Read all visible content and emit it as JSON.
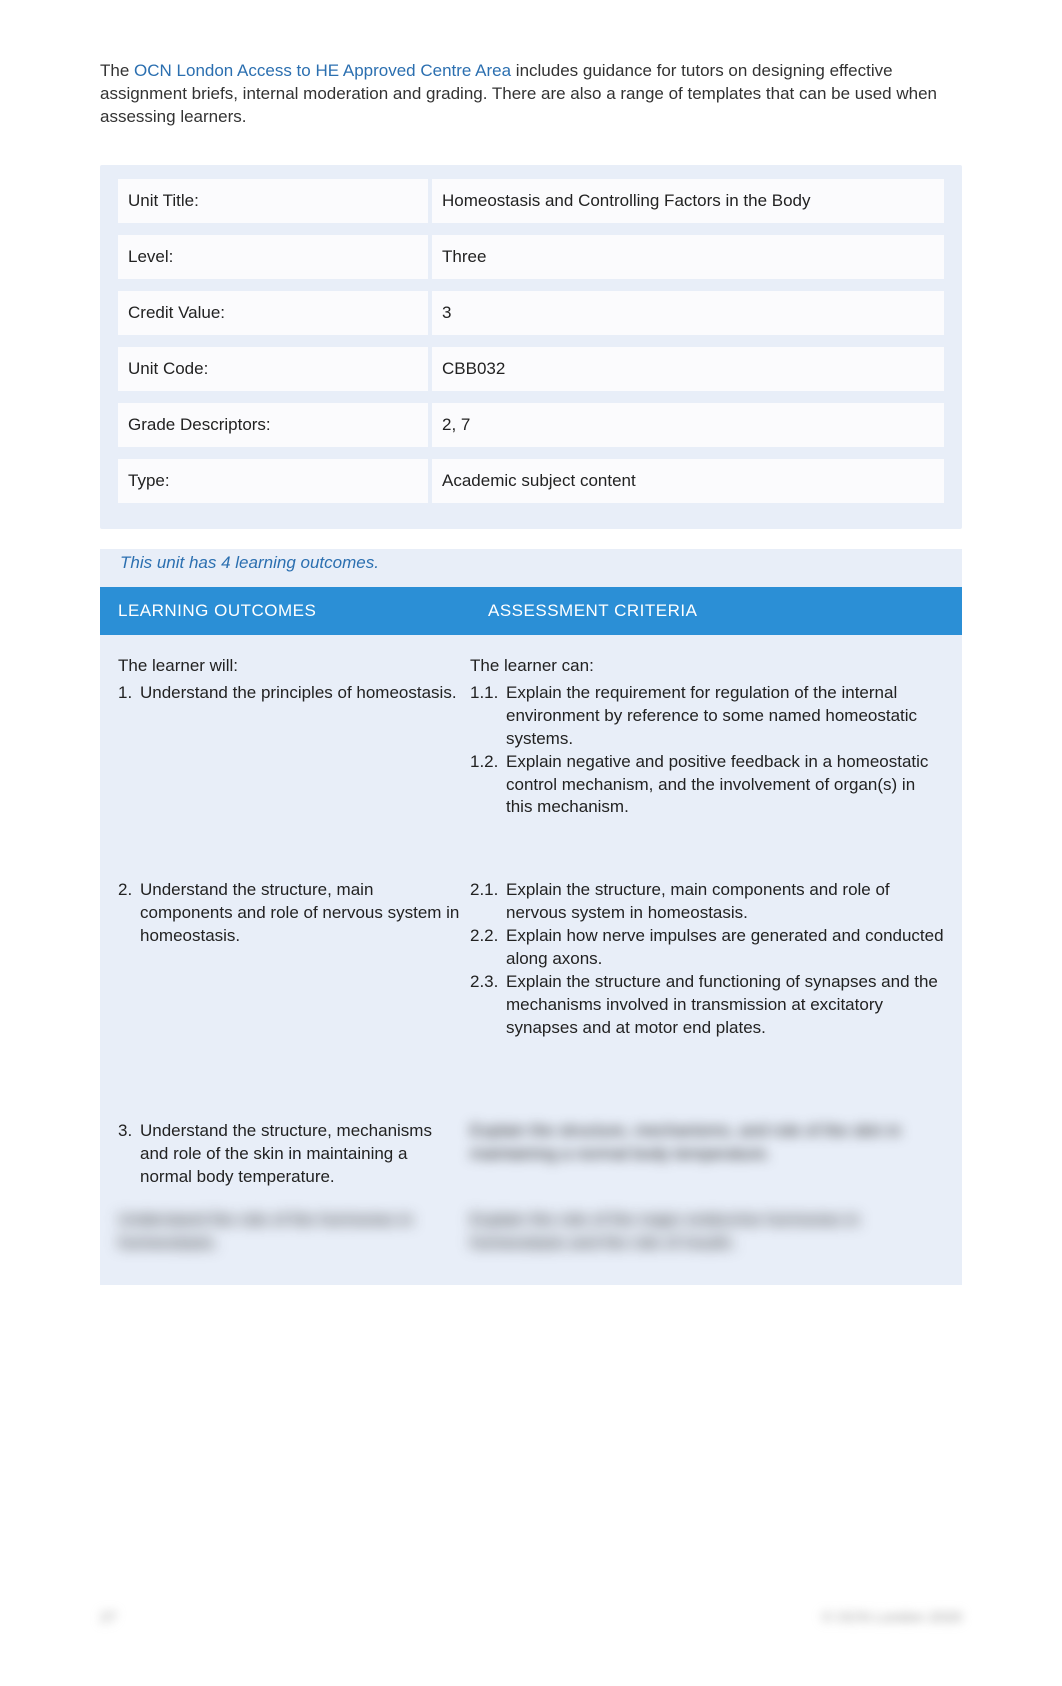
{
  "intro": {
    "prefix": "The ",
    "link": "OCN London Access to HE Approved Centre Area",
    "suffix": " includes guidance for tutors on designing effective assignment briefs, internal moderation and grading. There are also a range of templates that can be used when assessing learners."
  },
  "unit_info": [
    {
      "label": "Unit Title:",
      "value": "Homeostasis and Controlling Factors in the Body"
    },
    {
      "label": "Level:",
      "value": "Three"
    },
    {
      "label": "Credit Value:",
      "value": "3"
    },
    {
      "label": "Unit Code:",
      "value": "CBB032"
    },
    {
      "label": "Grade Descriptors:",
      "value": "2, 7"
    },
    {
      "label": "Type:",
      "value": "Academic subject content"
    }
  ],
  "outcomes_note": "This unit has 4 learning outcomes.",
  "headers": {
    "left": "LEARNING OUTCOMES",
    "right": "ASSESSMENT CRITERIA"
  },
  "learner_will": "The learner will:",
  "learner_can": "The learner can:",
  "rows": [
    {
      "lo_num": "1.",
      "lo_text": "Understand the principles of homeostasis.",
      "ac": [
        {
          "num": "1.1.",
          "text": "Explain the requirement for regulation of the internal environment by reference to some named homeostatic systems."
        },
        {
          "num": "1.2.",
          "text": "Explain negative and positive feedback in a homeostatic control mechanism, and the involvement of organ(s) in this mechanism."
        }
      ]
    },
    {
      "lo_num": "2.",
      "lo_text": "Understand the structure, main components and role of nervous system in homeostasis.",
      "ac": [
        {
          "num": "2.1.",
          "text": "Explain the structure, main components and role of nervous system in homeostasis."
        },
        {
          "num": "2.2.",
          "text": "Explain how nerve impulses are generated and conducted along axons."
        },
        {
          "num": "2.3.",
          "text": "Explain the structure and functioning of synapses and the mechanisms involved in transmission at excitatory synapses and at motor end plates."
        }
      ]
    },
    {
      "lo_num": "3.",
      "lo_text": "Understand the structure, mechanisms and role of the skin in maintaining a normal body temperature.",
      "ac_blurred": "Explain the structure, mechanisms, and role of the skin in maintaining a normal body temperature."
    }
  ],
  "blurred_row": {
    "lo": "Understand the role of the hormones in homeostasis.",
    "ac": "Explain the role of the major endocrine hormones in homeostasis and the role of insulin."
  },
  "footer": {
    "left": "27",
    "right": "© OCN London 2020"
  }
}
